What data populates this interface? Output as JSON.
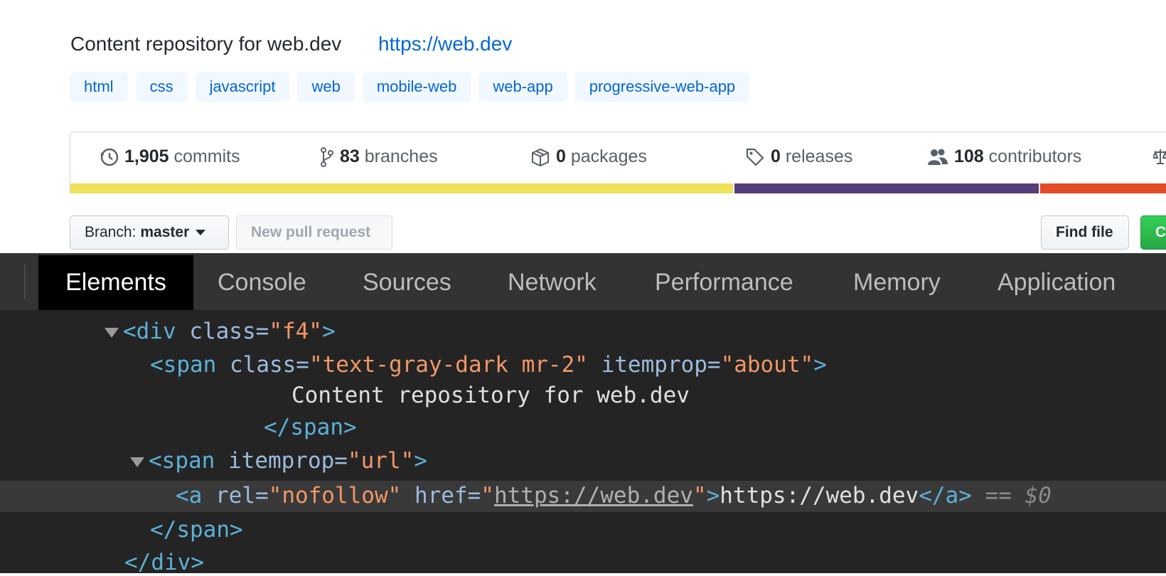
{
  "repo": {
    "about": "Content repository for web.dev",
    "url": "https://web.dev",
    "topics": [
      "html",
      "css",
      "javascript",
      "web",
      "mobile-web",
      "web-app",
      "progressive-web-app"
    ]
  },
  "stats": {
    "commits": {
      "count": "1,905",
      "label": "commits",
      "icon": "history-icon"
    },
    "branches": {
      "count": "83",
      "label": "branches",
      "icon": "branch-icon"
    },
    "packages": {
      "count": "0",
      "label": "packages",
      "icon": "package-icon"
    },
    "releases": {
      "count": "0",
      "label": "releases",
      "icon": "tag-icon"
    },
    "contributors": {
      "count": "108",
      "label": "contributors",
      "icon": "people-icon"
    }
  },
  "language_bar": [
    {
      "color": "#f1e05a",
      "fraction": 0.606
    },
    {
      "color": "#563d7c",
      "fraction": 0.279
    },
    {
      "color": "#e34c26",
      "fraction": 0.115
    }
  ],
  "buttons": {
    "branch_prefix": "Branch:",
    "branch_name": "master",
    "new_pull_request": "New pull request",
    "find_file": "Find file",
    "clone": "C"
  },
  "devtools": {
    "tabs": [
      "Elements",
      "Console",
      "Sources",
      "Network",
      "Performance",
      "Memory",
      "Application"
    ],
    "active_tab": "Elements",
    "dom": {
      "line1": {
        "open": "<div",
        "attr": " class=",
        "val": "\"f4\"",
        "close": ">"
      },
      "line2": {
        "open": "<span",
        "attr1": " class=",
        "val1": "\"text-gray-dark mr-2\"",
        "attr2": " itemprop=",
        "val2": "\"about\"",
        "close": ">"
      },
      "line3": "Content repository for web.dev",
      "line4": "</span>",
      "line5": {
        "open": "<span",
        "attr": " itemprop=",
        "val": "\"url\"",
        "close": ">"
      },
      "line6": {
        "open": "<a",
        "attr1": " rel=",
        "val1": "\"nofollow\"",
        "attr2": " href=",
        "quote": "\"",
        "href": "https://web.dev",
        "quote_close": "\"",
        "gt": ">",
        "text": "https://web.dev",
        "end": "</a>",
        "eq": " == ",
        "ref": "$0"
      },
      "line7": "</span>",
      "line8": "</div>"
    }
  }
}
